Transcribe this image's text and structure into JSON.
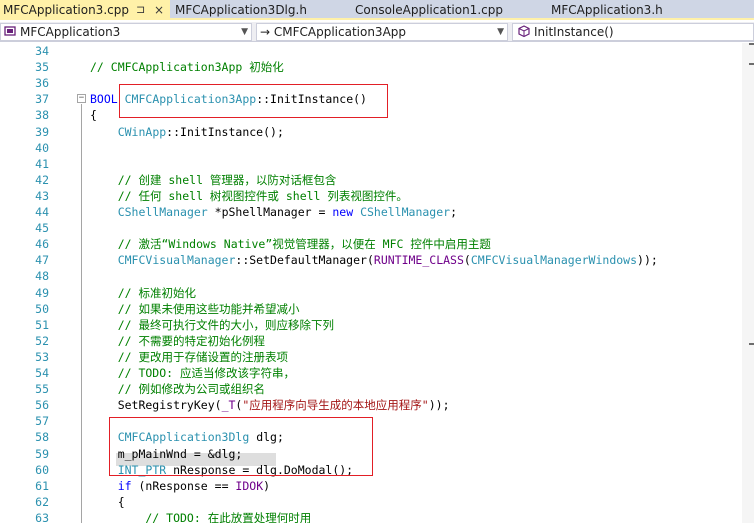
{
  "tabs": [
    {
      "label": "MFCApplication3.cpp",
      "active": true,
      "pin": "⊐",
      "close": "×"
    },
    {
      "label": "MFCApplication3Dlg.h",
      "active": false
    },
    {
      "label": "ConsoleApplication1.cpp",
      "active": false
    },
    {
      "label": "MFCApplication3.h",
      "active": false
    }
  ],
  "nav": {
    "project": {
      "icon": "project-icon",
      "value": "MFCApplication3"
    },
    "scope": {
      "icon": "arrow-icon",
      "value": "→ CMFCApplication3App"
    },
    "member": {
      "icon": "method-cube-icon",
      "value": "InitInstance()"
    }
  },
  "code_lines": [
    {
      "num": "34",
      "tokens": []
    },
    {
      "num": "35",
      "tokens": [
        {
          "t": "// CMFCApplication3App 初始化",
          "c": "comment"
        }
      ]
    },
    {
      "num": "36",
      "tokens": []
    },
    {
      "num": "37",
      "tokens": [
        {
          "t": "BOOL ",
          "c": "keyword"
        },
        {
          "t": "CMFCApplication3App",
          "c": "type"
        },
        {
          "t": "::InitInstance()",
          "c": "plain"
        }
      ]
    },
    {
      "num": "38",
      "tokens": [
        {
          "t": "{",
          "c": "plain"
        }
      ]
    },
    {
      "num": "39",
      "tokens": [
        {
          "t": "    ",
          "c": "plain"
        },
        {
          "t": "CWinApp",
          "c": "type"
        },
        {
          "t": "::InitInstance();",
          "c": "plain"
        }
      ]
    },
    {
      "num": "40",
      "tokens": []
    },
    {
      "num": "41",
      "tokens": []
    },
    {
      "num": "42",
      "tokens": [
        {
          "t": "    // 创建 shell 管理器，以防对话框包含",
          "c": "comment"
        }
      ]
    },
    {
      "num": "43",
      "tokens": [
        {
          "t": "    // 任何 shell 树视图控件或 shell 列表视图控件。",
          "c": "comment"
        }
      ]
    },
    {
      "num": "44",
      "tokens": [
        {
          "t": "    ",
          "c": "plain"
        },
        {
          "t": "CShellManager",
          "c": "type"
        },
        {
          "t": " *pShellManager",
          "c": "plain"
        },
        {
          "t": " = ",
          "c": "plain"
        },
        {
          "t": "new ",
          "c": "keyword"
        },
        {
          "t": "CShellManager",
          "c": "type"
        },
        {
          "t": ";",
          "c": "plain"
        }
      ]
    },
    {
      "num": "45",
      "tokens": []
    },
    {
      "num": "46",
      "tokens": [
        {
          "t": "    // 激活“Windows Native”视觉管理器，以便在 MFC 控件中启用主题",
          "c": "comment"
        }
      ]
    },
    {
      "num": "47",
      "tokens": [
        {
          "t": "    ",
          "c": "plain"
        },
        {
          "t": "CMFCVisualManager",
          "c": "type"
        },
        {
          "t": "::SetDefaultManager(",
          "c": "plain"
        },
        {
          "t": "RUNTIME_CLASS",
          "c": "macro"
        },
        {
          "t": "(",
          "c": "plain"
        },
        {
          "t": "CMFCVisualManagerWindows",
          "c": "type"
        },
        {
          "t": "));",
          "c": "plain"
        }
      ]
    },
    {
      "num": "48",
      "tokens": []
    },
    {
      "num": "49",
      "tokens": [
        {
          "t": "    // 标准初始化",
          "c": "comment"
        }
      ]
    },
    {
      "num": "50",
      "tokens": [
        {
          "t": "    // 如果未使用这些功能并希望减小",
          "c": "comment"
        }
      ]
    },
    {
      "num": "51",
      "tokens": [
        {
          "t": "    // 最终可执行文件的大小，则应移除下列",
          "c": "comment"
        }
      ]
    },
    {
      "num": "52",
      "tokens": [
        {
          "t": "    // 不需要的特定初始化例程",
          "c": "comment"
        }
      ]
    },
    {
      "num": "53",
      "tokens": [
        {
          "t": "    // 更改用于存储设置的注册表项",
          "c": "comment"
        }
      ]
    },
    {
      "num": "54",
      "tokens": [
        {
          "t": "    // TODO: 应适当修改该字符串，",
          "c": "comment"
        }
      ]
    },
    {
      "num": "55",
      "tokens": [
        {
          "t": "    // 例如修改为公司或组织名",
          "c": "comment"
        }
      ]
    },
    {
      "num": "56",
      "tokens": [
        {
          "t": "    SetRegistryKey(",
          "c": "plain"
        },
        {
          "t": "_T",
          "c": "macro"
        },
        {
          "t": "(",
          "c": "plain"
        },
        {
          "t": "\"应用程序向导生成的本地应用程序\"",
          "c": "string"
        },
        {
          "t": "));",
          "c": "plain"
        }
      ]
    },
    {
      "num": "57",
      "tokens": []
    },
    {
      "num": "58",
      "tokens": [
        {
          "t": "    ",
          "c": "plain"
        },
        {
          "t": "CMFCApplication3Dlg",
          "c": "type"
        },
        {
          "t": " dlg;",
          "c": "plain"
        }
      ]
    },
    {
      "num": "59",
      "tokens": [
        {
          "t": "    m_pMainWnd = &dlg;",
          "c": "plain"
        }
      ]
    },
    {
      "num": "60",
      "tokens": [
        {
          "t": "    ",
          "c": "plain"
        },
        {
          "t": "INT_PTR",
          "c": "type"
        },
        {
          "t": " nResponse = dlg.DoModal();",
          "c": "plain"
        }
      ]
    },
    {
      "num": "61",
      "tokens": [
        {
          "t": "    ",
          "c": "plain"
        },
        {
          "t": "if",
          "c": "keyword"
        },
        {
          "t": " (nResponse == ",
          "c": "plain"
        },
        {
          "t": "IDOK",
          "c": "macro"
        },
        {
          "t": ")",
          "c": "plain"
        }
      ]
    },
    {
      "num": "62",
      "tokens": [
        {
          "t": "    {",
          "c": "plain"
        }
      ]
    },
    {
      "num": "63",
      "tokens": [
        {
          "t": "        // TODO: 在此放置处理何时用",
          "c": "comment"
        }
      ]
    }
  ]
}
